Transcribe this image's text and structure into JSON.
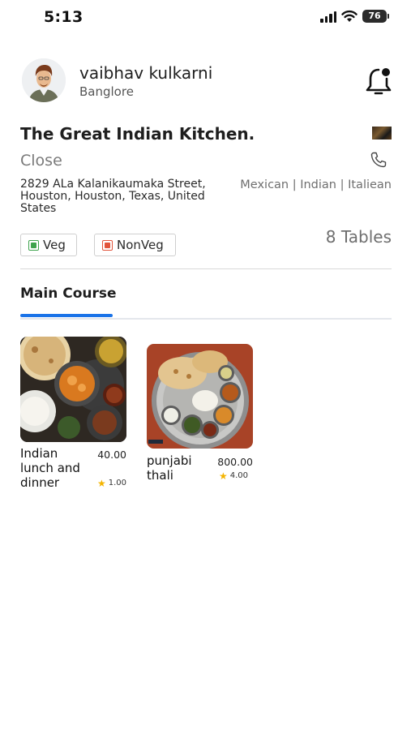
{
  "status_bar": {
    "time": "5:13",
    "battery": "76"
  },
  "profile": {
    "name": "vaibhav kulkarni",
    "city": "Banglore"
  },
  "restaurant": {
    "name": "The Great Indian Kitchen.",
    "status": "Close",
    "address": "2829 ALa Kalanikaumaka Street, Houston, Houston, Texas, United States",
    "cuisines": "Mexican | Indian | Italiean",
    "tables": "8 Tables"
  },
  "filters": {
    "veg": "Veg",
    "nonveg": "NonVeg"
  },
  "tabs": [
    {
      "label": "Main Course",
      "active": true
    }
  ],
  "dishes": [
    {
      "name": "Indian lunch and dinner",
      "price": "40.00",
      "rating": "1.00"
    },
    {
      "name": "punjabi thali",
      "price": "800.00",
      "rating": "4.00"
    }
  ],
  "colors": {
    "accent": "#1a73e8",
    "veg": "#3fa34d",
    "nonveg": "#e2543b",
    "star": "#f4b400"
  }
}
